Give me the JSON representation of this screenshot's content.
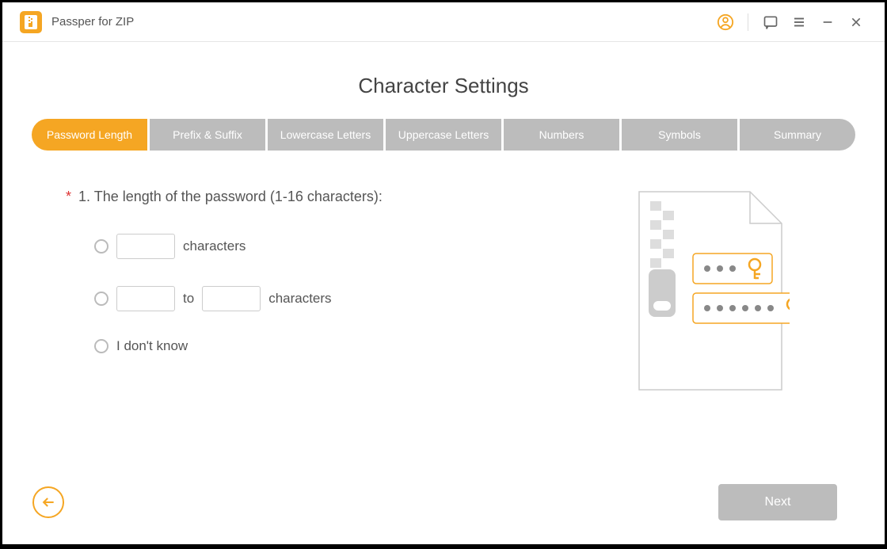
{
  "app": {
    "title": "Passper for ZIP"
  },
  "page": {
    "title": "Character Settings"
  },
  "tabs": [
    "Password Length",
    "Prefix & Suffix",
    "Lowercase Letters",
    "Uppercase Letters",
    "Numbers",
    "Symbols",
    "Summary"
  ],
  "question": {
    "asterisk": "*",
    "text": "1. The length of the password (1-16 characters):"
  },
  "options": {
    "exact_suffix": "characters",
    "range_middle": "to",
    "range_suffix": "characters",
    "dont_know": "I don't know"
  },
  "footer": {
    "next": "Next"
  },
  "colors": {
    "accent": "#f5a623",
    "tab_inactive": "#bcbcbc"
  }
}
